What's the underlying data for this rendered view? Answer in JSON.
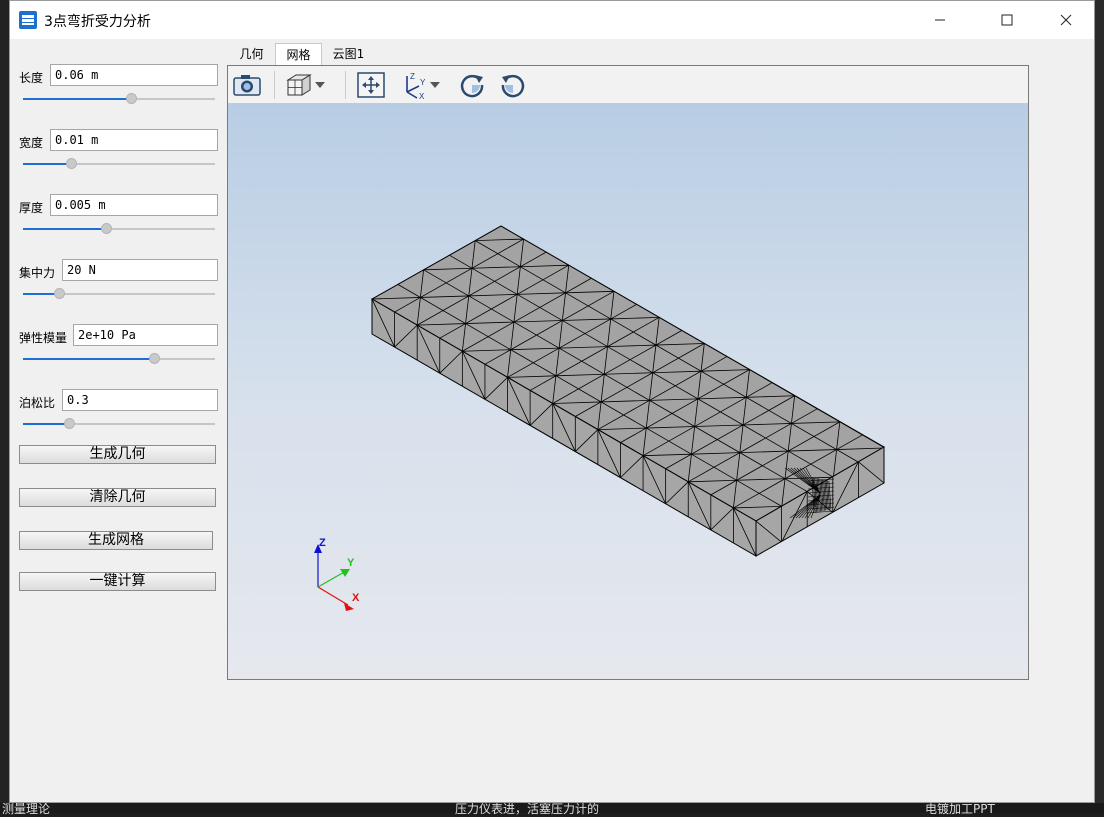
{
  "window": {
    "title": "3点弯折受力分析"
  },
  "params": [
    {
      "label": "长度",
      "value": "0.06 m",
      "slider": 0.56
    },
    {
      "label": "宽度",
      "value": "0.01 m",
      "slider": 0.25
    },
    {
      "label": "厚度",
      "value": "0.005 m",
      "slider": 0.43
    },
    {
      "label": "集中力",
      "value": "20 N",
      "slider": 0.19
    },
    {
      "label": "弹性模量",
      "value": "2e+10 Pa",
      "slider": 0.68
    },
    {
      "label": "泊松比",
      "value": "0.3",
      "slider": 0.24
    }
  ],
  "actions": {
    "generate_geometry": "生成几何",
    "clear_geometry": "清除几何",
    "generate_mesh": "生成网格",
    "one_click_compute": "一键计算"
  },
  "tabs": [
    {
      "label": "几何",
      "active": false
    },
    {
      "label": "网格",
      "active": true
    },
    {
      "label": "云图1",
      "active": false
    }
  ],
  "toolbar": {
    "icons": [
      "camera-icon",
      "view-cube-icon",
      "fit-view-icon",
      "axes-orientation-icon",
      "rotate-clockwise-icon",
      "rotate-counterclockwise-icon"
    ]
  },
  "axes": {
    "x": "X",
    "y": "Y",
    "z": "Z"
  },
  "colors": {
    "accent": "#1f6fd1",
    "mesh_fill": "#a3a3a3",
    "mesh_edge": "#000000",
    "axis_x": "#e01010",
    "axis_y": "#1cc41c",
    "axis_z": "#1010d0"
  },
  "desktop": {
    "bottom_texts": [
      "测量理论",
      "压力仪表进，活塞压力计的",
      "电镀加工PPT"
    ]
  }
}
